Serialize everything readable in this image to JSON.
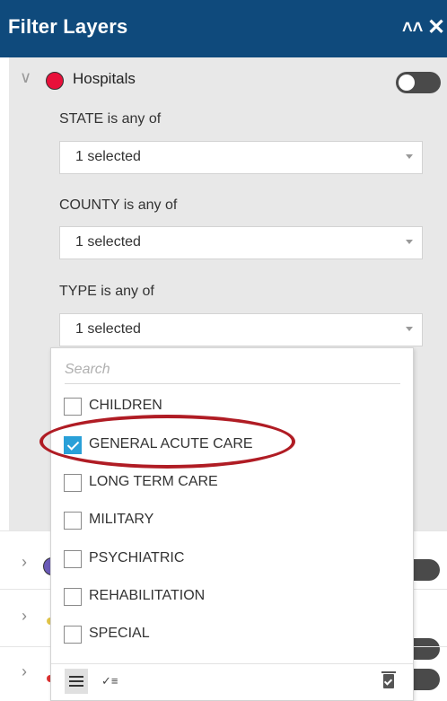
{
  "header": {
    "title": "Filter Layers",
    "collapse_icon": "double-chevron-up-icon",
    "close_icon": "close-icon"
  },
  "layer": {
    "name": "Hospitals",
    "color": "#e8103a",
    "toggle_on": false
  },
  "filters": [
    {
      "label": "STATE is any of",
      "value": "1 selected"
    },
    {
      "label": "COUNTY is any of",
      "value": "1 selected"
    },
    {
      "label": "TYPE is any of",
      "value": "1 selected"
    }
  ],
  "dropdown": {
    "search_placeholder": "Search",
    "options": [
      {
        "label": "CHILDREN",
        "checked": false
      },
      {
        "label": "GENERAL ACUTE CARE",
        "checked": true
      },
      {
        "label": "LONG TERM CARE",
        "checked": false
      },
      {
        "label": "MILITARY",
        "checked": false
      },
      {
        "label": "PSYCHIATRIC",
        "checked": false
      },
      {
        "label": "REHABILITATION",
        "checked": false
      },
      {
        "label": "SPECIAL",
        "checked": false
      }
    ]
  },
  "colors": {
    "header_bg": "#0f4a7c",
    "checkbox_checked": "#2aa0d8",
    "highlight_ring": "#b01c24"
  }
}
